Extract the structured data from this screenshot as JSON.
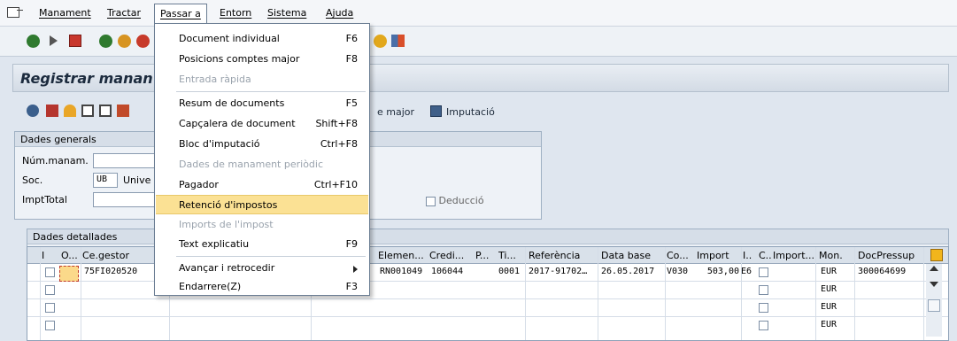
{
  "menubar": {
    "items": [
      "Manament",
      "Tractar",
      "Passar a",
      "Entorn",
      "Sistema",
      "Ajuda"
    ]
  },
  "title": "Registrar manan",
  "app_toolbar": {
    "links": [
      "e major",
      "Imputació"
    ]
  },
  "general_data": {
    "title": "Dades generals",
    "labels": [
      "Núm.manam.",
      "Soc.",
      "ImptTotal"
    ],
    "company_value": "UB",
    "univ_label": "Unive",
    "deduction_label": "Deducció"
  },
  "detail_data": {
    "title": "Dades detallades",
    "columns": [
      "I",
      "O...",
      "Ce.gestor",
      "Elemen...",
      "Credi...",
      "P...",
      "Ti...",
      "Referència",
      "Data base",
      "Co...",
      "Import",
      "I..",
      "C..",
      "Import...",
      "Mon.",
      "DocPressup"
    ],
    "rows": [
      {
        "cegestor": "75FI020520",
        "elem": "RN001049",
        "credi": "106044",
        "ti": "0001",
        "ref": "2017-91702…",
        "date": "26.05.2017",
        "co": "V030",
        "import": "503,00",
        "i": "E6",
        "mon": "EUR",
        "doc": "300064699"
      },
      {
        "mon": "EUR"
      },
      {
        "mon": "EUR"
      },
      {
        "mon": "EUR"
      }
    ]
  },
  "dropdown": {
    "items": [
      {
        "label": "Document individual",
        "shortcut": "F6",
        "disabled": false
      },
      {
        "label": "Posicions comptes major",
        "shortcut": "F8",
        "disabled": false
      },
      {
        "label": "Entrada ràpida",
        "shortcut": "",
        "disabled": true
      },
      {
        "label": "Resum de documents",
        "shortcut": "F5",
        "disabled": false
      },
      {
        "label": "Capçalera de document",
        "shortcut": "Shift+F8",
        "disabled": false
      },
      {
        "label": "Bloc d'imputació",
        "shortcut": "Ctrl+F8",
        "disabled": false
      },
      {
        "label": "Dades de manament periòdic",
        "shortcut": "",
        "disabled": true
      },
      {
        "label": "Pagador",
        "shortcut": "Ctrl+F10",
        "disabled": false
      },
      {
        "label": "Retenció d'impostos",
        "shortcut": "",
        "disabled": false
      },
      {
        "label": "Imports de l'impost",
        "shortcut": "",
        "disabled": true
      },
      {
        "label": "Text explicatiu",
        "shortcut": "F9",
        "disabled": false
      },
      {
        "label": "Avançar i retrocedir",
        "shortcut": "",
        "disabled": false
      },
      {
        "label": "Endarrere(Z)",
        "shortcut": "F3",
        "disabled": false
      }
    ]
  },
  "colors": {
    "selected": "#fbe194",
    "background": "#dfe6ef"
  },
  "icons": [
    "check-icon",
    "play-icon",
    "save-icon",
    "back-icon",
    "exit-icon",
    "cancel-icon",
    "help-icon",
    "layout-icon"
  ]
}
